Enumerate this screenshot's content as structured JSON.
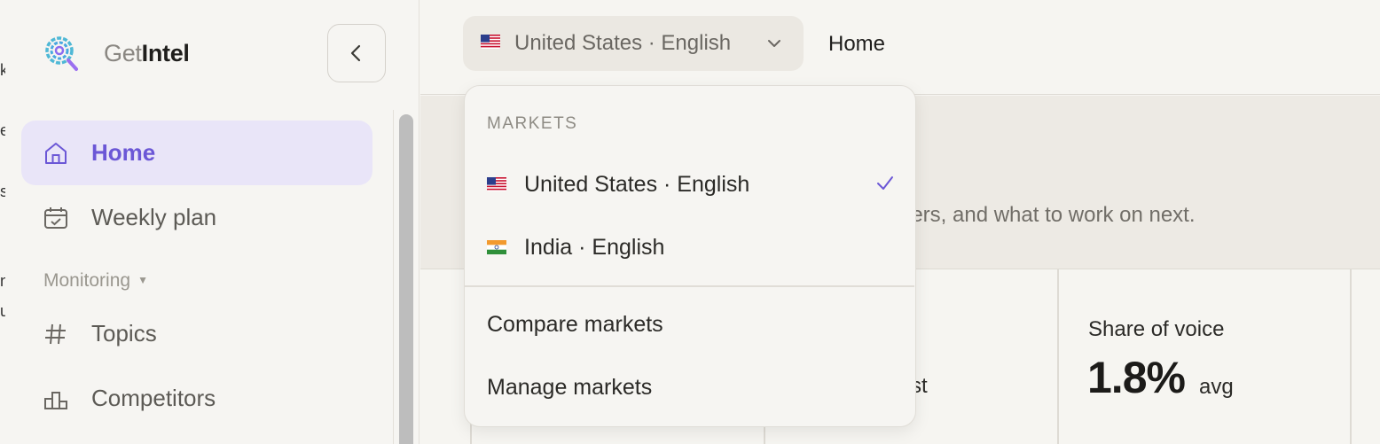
{
  "sidebar": {
    "brand": {
      "prefix": "Get",
      "name": "Intel"
    },
    "nav": [
      {
        "label": "Home",
        "icon": "home-icon",
        "active": true
      },
      {
        "label": "Weekly plan",
        "icon": "calendar-check-icon",
        "active": false
      }
    ],
    "section": {
      "label": "Monitoring",
      "icon": "caret-down-icon"
    },
    "monitoring": [
      {
        "label": "Topics",
        "icon": "hash-icon"
      },
      {
        "label": "Competitors",
        "icon": "podium-icon"
      }
    ],
    "edge_letters": [
      "k",
      "e",
      "s",
      "n",
      "u"
    ]
  },
  "header": {
    "market_selector": {
      "flag": "us-flag-icon",
      "label": "United States · English"
    },
    "page_title": "Home"
  },
  "dropdown": {
    "section_label": "MARKETS",
    "markets": [
      {
        "flag": "us-flag-icon",
        "label": "United States · English",
        "selected": true
      },
      {
        "flag": "in-flag-icon",
        "label": "India · English",
        "selected": false
      }
    ],
    "actions": [
      "Compare markets",
      "Manage markets"
    ]
  },
  "main": {
    "hero_subtitle_visible": "wers, and what to work on next.",
    "card_partial_text": "st",
    "share_of_voice": {
      "title": "Share of voice",
      "value": "1.8%",
      "unit": "avg"
    }
  },
  "colors": {
    "accent": "#6b57d6",
    "active_bg": "#e9e5f8",
    "background": "#f6f5f1"
  }
}
